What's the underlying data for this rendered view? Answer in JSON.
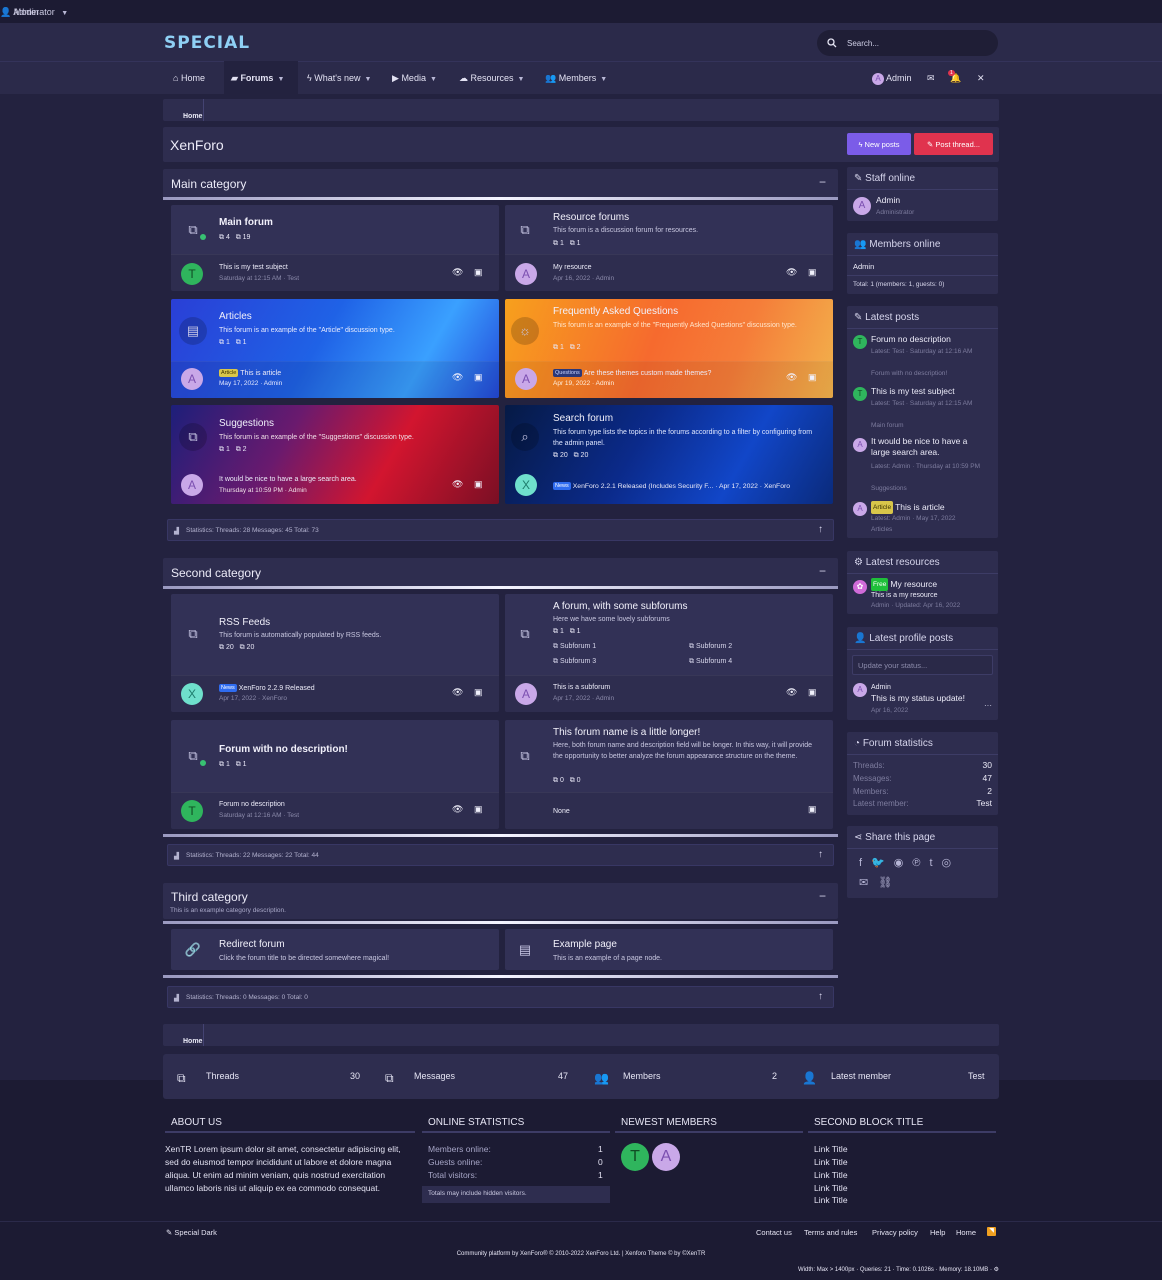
{
  "topbar": {
    "left": "Moderator",
    "right": "Admin"
  },
  "logo": "SPECIAL",
  "search": {
    "placeholder": "Search..."
  },
  "nav": {
    "home": "Home",
    "forums": "Forums",
    "whats_new": "What's new",
    "media": "Media",
    "resources": "Resources",
    "members": "Members",
    "admin": "Admin",
    "badge": "1"
  },
  "breadcrumb": {
    "home": "Home"
  },
  "page": {
    "title": "XenForo",
    "new_posts": "New posts",
    "post_thread": "Post thread..."
  },
  "categories": [
    {
      "title": "Main category",
      "statistics": "Statistics: Threads: 28 Messages: 45 Total: 73",
      "nodes": [
        {
          "title": "Main forum",
          "desc": "",
          "threads": "4",
          "messages": "19",
          "last_title": "This is my test subject",
          "last_meta": "Saturday at 12:15 AM · Test",
          "avatar": "T"
        },
        {
          "title": "Resource forums",
          "desc": "This forum is a discussion forum for resources.",
          "threads": "1",
          "messages": "1",
          "last_title": "My resource",
          "last_meta": "Apr 16, 2022 · Admin",
          "avatar": "A"
        },
        {
          "title": "Articles",
          "desc": "This forum is an example of the \"Article\" discussion type.",
          "threads": "1",
          "messages": "1",
          "last_prefix": "Article",
          "last_title": "This is article",
          "last_meta": "May 17, 2022 · Admin",
          "avatar": "A"
        },
        {
          "title": "Frequently Asked Questions",
          "desc": "This forum is an example of the \"Frequently Asked Questions\" discussion type.",
          "threads": "1",
          "messages": "2",
          "last_prefix": "Questions",
          "last_title": "Are these themes custom made themes?",
          "last_meta": "Apr 19, 2022 · Admin",
          "avatar": "A"
        },
        {
          "title": "Suggestions",
          "desc": "This forum is an example of the \"Suggestions\" discussion type.",
          "threads": "1",
          "messages": "2",
          "last_title": "It would be nice to have a large search area.",
          "last_meta": "Thursday at 10:59 PM · Admin",
          "avatar": "A"
        },
        {
          "title": "Search forum",
          "desc": "This forum type lists the topics in the forums according to a filter by configuring from the admin panel.",
          "threads": "20",
          "messages": "20",
          "last_prefix": "News",
          "last_title": "XenForo 2.2.1 Released (Includes Security F...",
          "last_meta": "Apr 17, 2022 · XenForo",
          "avatar": "X"
        }
      ]
    },
    {
      "title": "Second category",
      "statistics": "Statistics: Threads: 22 Messages: 22 Total: 44",
      "nodes": [
        {
          "title": "RSS Feeds",
          "desc": "This forum is automatically populated by RSS feeds.",
          "threads": "20",
          "messages": "20",
          "last_prefix": "News",
          "last_title": "XenForo 2.2.9 Released",
          "last_meta": "Apr 17, 2022 · XenForo",
          "avatar": "X"
        },
        {
          "title": "A forum, with some subforums",
          "desc": "Here we have some lovely subforums",
          "threads": "1",
          "messages": "1",
          "subforums": [
            "Subforum 1",
            "Subforum 2",
            "Subforum 3",
            "Subforum 4"
          ],
          "last_title": "This is a subforum",
          "last_meta": "Apr 17, 2022 · Admin",
          "avatar": "A"
        },
        {
          "title": "Forum with no description!",
          "desc": "",
          "threads": "1",
          "messages": "1",
          "last_title": "Forum no description",
          "last_meta": "Saturday at 12:16 AM · Test",
          "avatar": "T"
        },
        {
          "title": "This forum name is a little longer!",
          "desc": "Here, both forum name and description field will be longer. In this way, it will provide the opportunity to better analyze the forum appearance structure on the theme.",
          "threads": "0",
          "messages": "0",
          "last_title": "None"
        }
      ]
    },
    {
      "title": "Third category",
      "description": "This is an example category description.",
      "statistics": "Statistics: Threads: 0 Messages: 0 Total: 0",
      "nodes": [
        {
          "title": "Redirect forum",
          "desc": "Click the forum title to be directed somewhere magical!"
        },
        {
          "title": "Example page",
          "desc": "This is an example of a page node."
        }
      ]
    }
  ],
  "sidebar": {
    "staff_online": {
      "title": "Staff online",
      "name": "Admin",
      "role": "Administrator"
    },
    "members_online": {
      "title": "Members online",
      "list": "Admin",
      "total": "Total: 1 (members: 1, guests: 0)"
    },
    "latest_posts": {
      "title": "Latest posts",
      "items": [
        {
          "title": "Forum no description",
          "meta": "Latest: Test · Saturday at 12:16 AM",
          "forum": "Forum with no description!",
          "avatar": "T"
        },
        {
          "title": "This is my test subject",
          "meta": "Latest: Test · Saturday at 12:15 AM",
          "forum": "Main forum",
          "avatar": "T"
        },
        {
          "title": "It would be nice to have a large search area.",
          "meta": "Latest: Admin · Thursday at 10:59 PM",
          "forum": "Suggestions",
          "avatar": "A"
        },
        {
          "prefix": "Article",
          "title": "This is article",
          "meta": "Latest: Admin · May 17, 2022",
          "forum": "Articles",
          "avatar": "A"
        }
      ]
    },
    "latest_resources": {
      "title": "Latest resources",
      "prefix": "Free",
      "name": "My resource",
      "desc": "This is a my resource",
      "meta": "Admin · Updated: Apr 16, 2022"
    },
    "latest_profile_posts": {
      "title": "Latest profile posts",
      "placeholder": "Update your status...",
      "author": "Admin",
      "text": "This is my status update!",
      "date": "Apr 16, 2022",
      "more": "···"
    },
    "forum_statistics": {
      "title": "Forum statistics",
      "rows": [
        {
          "label": "Threads:",
          "value": "30"
        },
        {
          "label": "Messages:",
          "value": "47"
        },
        {
          "label": "Members:",
          "value": "2"
        },
        {
          "label": "Latest member:",
          "value": "Test"
        }
      ]
    },
    "share": {
      "title": "Share this page"
    }
  },
  "bottom_breadcrumb": {
    "home": "Home"
  },
  "footer_stats": [
    {
      "label": "Threads",
      "value": "30"
    },
    {
      "label": "Messages",
      "value": "47"
    },
    {
      "label": "Members",
      "value": "2"
    },
    {
      "label": "Latest member",
      "value": "Test"
    }
  ],
  "footer": {
    "about_title": "ABOUT US",
    "about_text": "XenTR Lorem ipsum dolor sit amet, consectetur adipiscing elit, sed do eiusmod tempor incididunt ut labore et dolore magna aliqua. Ut enim ad minim veniam, quis nostrud exercitation ullamco laboris nisi ut aliquip ex ea commodo consequat.",
    "online_title": "ONLINE STATISTICS",
    "online_rows": [
      {
        "label": "Members online:",
        "value": "1"
      },
      {
        "label": "Guests online:",
        "value": "0"
      },
      {
        "label": "Total visitors:",
        "value": "1"
      }
    ],
    "online_note": "Totals may include hidden visitors.",
    "newest_title": "NEWEST MEMBERS",
    "newest": [
      "T",
      "A"
    ],
    "second_title": "SECOND BLOCK TITLE",
    "links": [
      "Link Title",
      "Link Title",
      "Link Title",
      "Link Title",
      "Link Title"
    ],
    "style": "Special Dark",
    "bottom_links": [
      "Contact us",
      "Terms and rules",
      "Privacy policy",
      "Help",
      "Home"
    ],
    "copyright": "Community platform by XenForo® © 2010-2022 XenForo Ltd. | Xenforo Theme © by ©XenTR",
    "debug": "Width: Max > 1400px · Queries: 21 · Time: 0.1026s · Memory: 18.10MB · ⚙"
  }
}
